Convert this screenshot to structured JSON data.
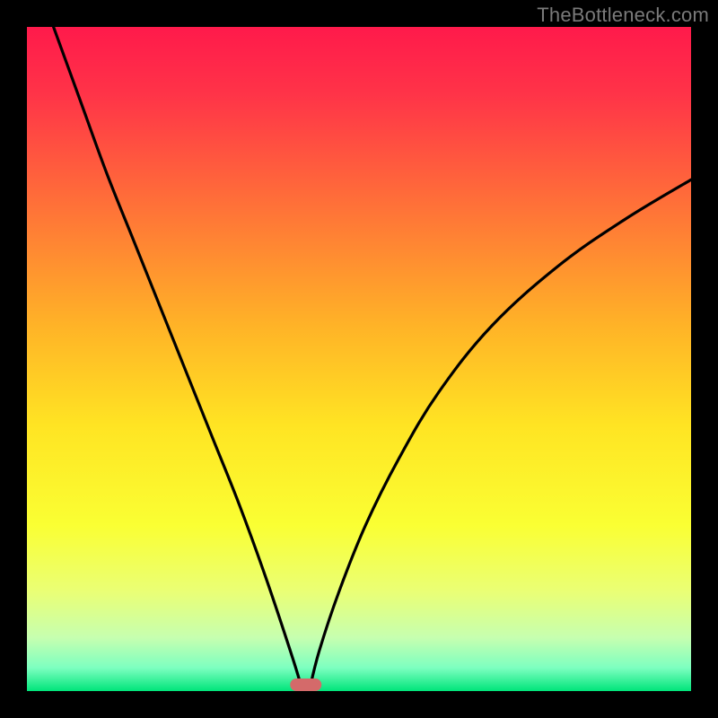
{
  "watermark": "TheBottleneck.com",
  "colors": {
    "frame": "#000000",
    "curve": "#000000",
    "marker": "#d46a6a",
    "gradient_stops": [
      {
        "offset": 0.0,
        "color": "#ff1a4b"
      },
      {
        "offset": 0.1,
        "color": "#ff3348"
      },
      {
        "offset": 0.25,
        "color": "#ff6a3a"
      },
      {
        "offset": 0.45,
        "color": "#ffb327"
      },
      {
        "offset": 0.6,
        "color": "#ffe423"
      },
      {
        "offset": 0.75,
        "color": "#faff33"
      },
      {
        "offset": 0.85,
        "color": "#eaff75"
      },
      {
        "offset": 0.92,
        "color": "#c6ffb0"
      },
      {
        "offset": 0.965,
        "color": "#7dffc0"
      },
      {
        "offset": 1.0,
        "color": "#00e57a"
      }
    ]
  },
  "chart_data": {
    "type": "line",
    "title": "",
    "xlabel": "",
    "ylabel": "",
    "xlim": [
      0,
      100
    ],
    "ylim": [
      0,
      100
    ],
    "min_x": 42,
    "series": [
      {
        "name": "left-branch",
        "x": [
          4,
          8,
          12,
          16,
          20,
          24,
          28,
          32,
          36,
          40,
          41.5
        ],
        "values": [
          100,
          89,
          78,
          68,
          58,
          48,
          38,
          28,
          17,
          5,
          0
        ]
      },
      {
        "name": "right-branch",
        "x": [
          42.5,
          44,
          47,
          51,
          56,
          62,
          70,
          80,
          90,
          100
        ],
        "values": [
          0,
          6,
          15,
          25,
          35,
          45,
          55,
          64,
          71,
          77
        ]
      }
    ],
    "marker": {
      "x_center": 42,
      "width_pct": 4.8,
      "height_pct": 1.9
    }
  }
}
